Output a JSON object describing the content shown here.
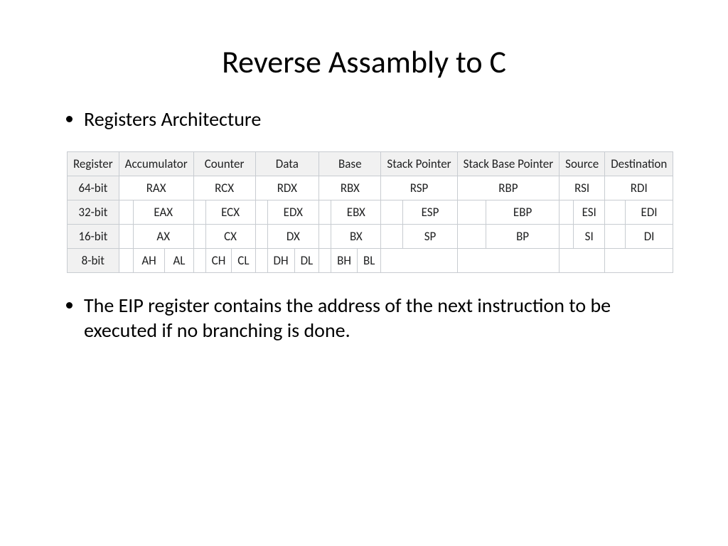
{
  "title": "Reverse Assambly to C",
  "bullet1": "Registers Architecture",
  "bullet2": "The EIP register contains the address of the next instruction to be executed if no branching is done.",
  "table": {
    "headers": [
      "Register",
      "Accumulator",
      "Counter",
      "Data",
      "Base",
      "Stack Pointer",
      "Stack Base Pointer",
      "Source",
      "Destination"
    ],
    "row64": {
      "label": "64-bit",
      "cells": [
        "RAX",
        "RCX",
        "RDX",
        "RBX",
        "RSP",
        "RBP",
        "RSI",
        "RDI"
      ]
    },
    "row32": {
      "label": "32-bit",
      "cells": [
        "EAX",
        "ECX",
        "EDX",
        "EBX",
        "ESP",
        "EBP",
        "ESI",
        "EDI"
      ]
    },
    "row16": {
      "label": "16-bit",
      "cells": [
        "AX",
        "CX",
        "DX",
        "BX",
        "SP",
        "BP",
        "SI",
        "DI"
      ]
    },
    "row8": {
      "label": "8-bit",
      "pairs": [
        [
          "AH",
          "AL"
        ],
        [
          "CH",
          "CL"
        ],
        [
          "DH",
          "DL"
        ],
        [
          "BH",
          "BL"
        ]
      ]
    }
  }
}
